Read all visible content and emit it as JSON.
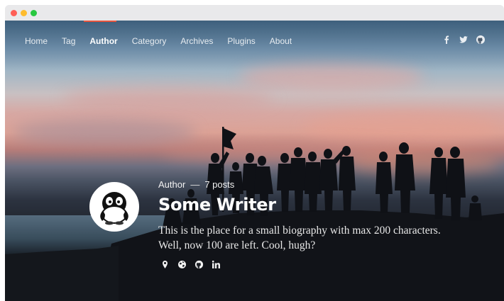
{
  "window": {
    "controls": [
      "close",
      "minimize",
      "maximize"
    ]
  },
  "nav": {
    "items": [
      {
        "label": "Home",
        "active": false
      },
      {
        "label": "Tag",
        "active": false
      },
      {
        "label": "Author",
        "active": true
      },
      {
        "label": "Category",
        "active": false
      },
      {
        "label": "Archives",
        "active": false
      },
      {
        "label": "Plugins",
        "active": false
      },
      {
        "label": "About",
        "active": false
      }
    ]
  },
  "social": {
    "icons": [
      "facebook-icon",
      "twitter-icon",
      "github-icon"
    ]
  },
  "author": {
    "role": "Author",
    "dash": "—",
    "post_count": "7 posts",
    "name": "Some Writer",
    "bio": "This is the place for a small biography with max 200 characters. Well, now 100 are left. Cool, hugh?",
    "links": [
      "location-icon",
      "globe-icon",
      "github-icon",
      "linkedin-icon"
    ]
  },
  "colors": {
    "accent": "#e8553e",
    "text": "#ffffff"
  }
}
